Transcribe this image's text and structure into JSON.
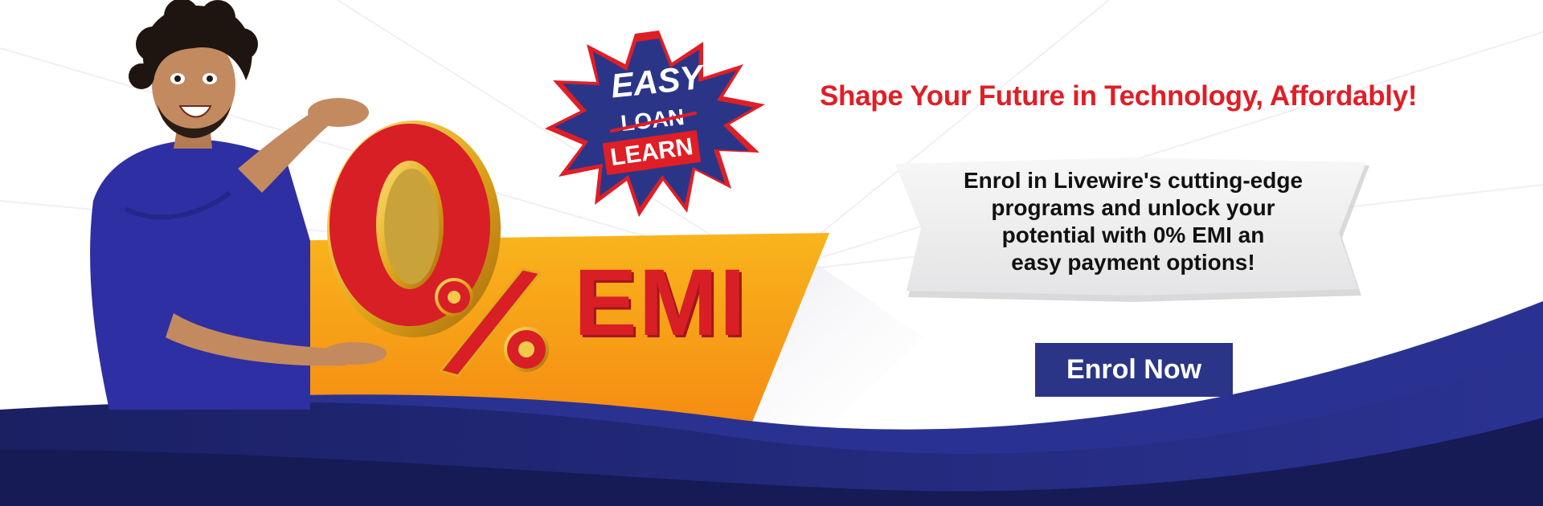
{
  "burst": {
    "easy": "EASY",
    "loan": "LOAN",
    "learn": "LEARN"
  },
  "offer": {
    "emi_label": "EMI",
    "zero_digit": "0",
    "percent_sign": "%"
  },
  "headline": "Shape Your Future in Technology, Affordably!",
  "callout": {
    "line1": "Enrol in Livewire's cutting-edge",
    "line2": "programs and unlock your",
    "line3": "potential with 0% EMI an",
    "line4": "easy payment options!"
  },
  "cta": {
    "label": "Enrol Now"
  },
  "colors": {
    "brand_red": "#e01e26",
    "brand_blue": "#2b3588",
    "navy": "#1a1f5e",
    "orange": "#f7a11a"
  }
}
